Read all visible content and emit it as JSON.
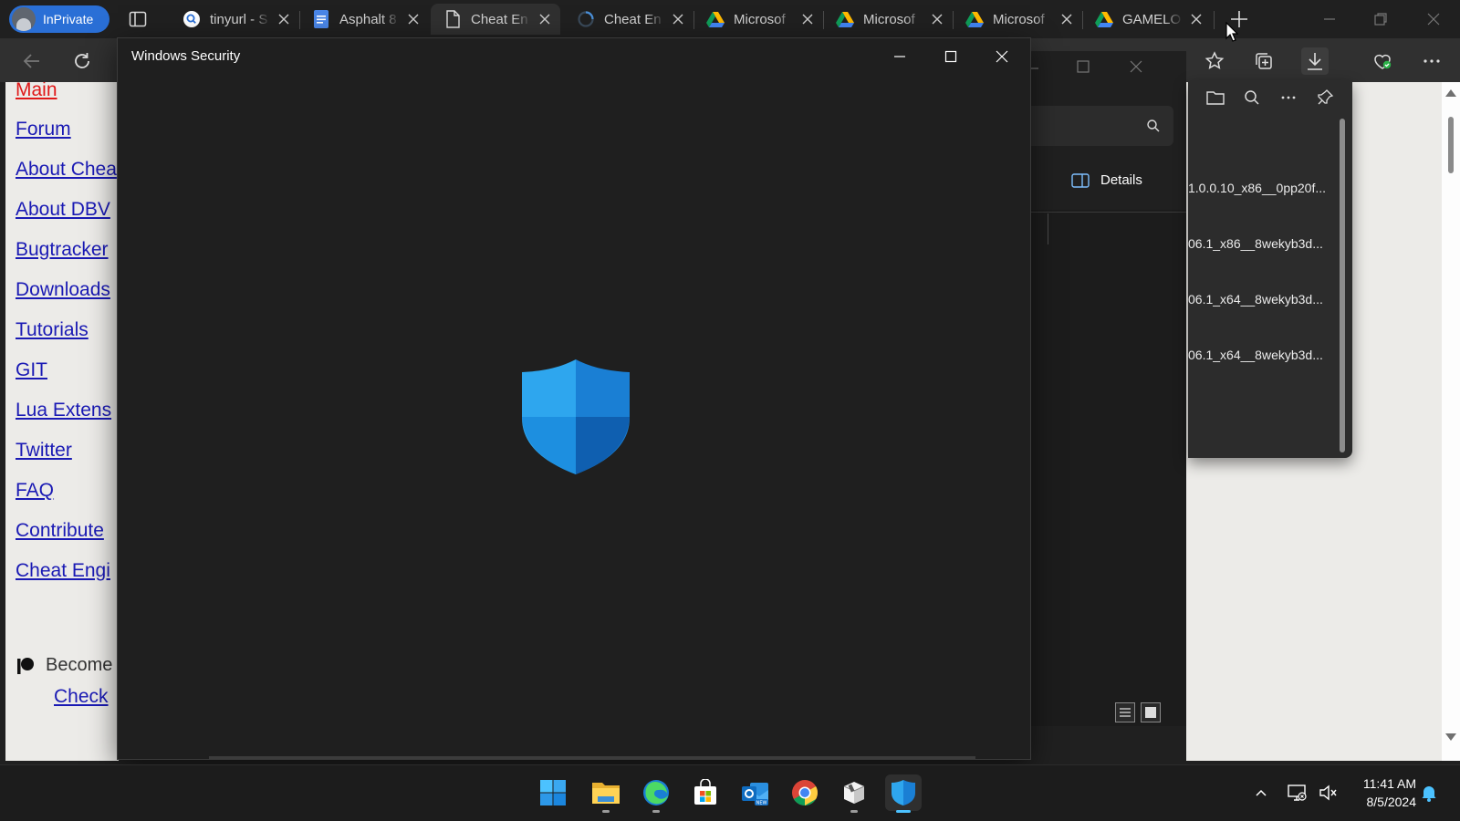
{
  "browser": {
    "inprivate_label": "InPrivate",
    "tabs": [
      {
        "title": "tinyurl - S",
        "icon": "search-icon"
      },
      {
        "title": "Asphalt 8",
        "icon": "google-docs-icon"
      },
      {
        "title": "Cheat En",
        "icon": "page-icon",
        "active": true
      },
      {
        "title": "Cheat En",
        "icon": "loading-icon"
      },
      {
        "title": "Microsof",
        "icon": "google-drive-icon"
      },
      {
        "title": "Microsof",
        "icon": "google-drive-icon"
      },
      {
        "title": "Microsof",
        "icon": "google-drive-icon"
      },
      {
        "title": "GAMELO",
        "icon": "google-drive-icon"
      }
    ],
    "accent": "#2a6fd6"
  },
  "webpage": {
    "nav_links": [
      "Main",
      "Forum",
      "About Chea",
      "About DBV",
      "Bugtracker",
      "Downloads",
      "Tutorials",
      "GIT",
      "Lua Extens",
      "Twitter",
      "FAQ",
      "Contribute",
      "Cheat Engi"
    ],
    "current_link": "Main",
    "patreon_text": "Become",
    "check_link": "Check"
  },
  "explorer": {
    "details_label": "Details"
  },
  "downloads": {
    "items": [
      "1.0.0.10_x86__0pp20f...",
      "06.1_x86__8wekyb3d...",
      "06.1_x64__8wekyb3d...",
      "06.1_x64__8wekyb3d..."
    ]
  },
  "windows_security": {
    "title": "Windows Security",
    "shield_colors": [
      "#2ea6ee",
      "#1a7fd4",
      "#0f5fb0"
    ]
  },
  "taskbar": {
    "apps": [
      "windows-start-icon",
      "file-explorer-icon",
      "edge-icon",
      "microsoft-store-icon",
      "outlook-new-icon",
      "chrome-icon",
      "package-icon",
      "windows-security-icon"
    ],
    "time": "11:41 AM",
    "date": "8/5/2024"
  }
}
